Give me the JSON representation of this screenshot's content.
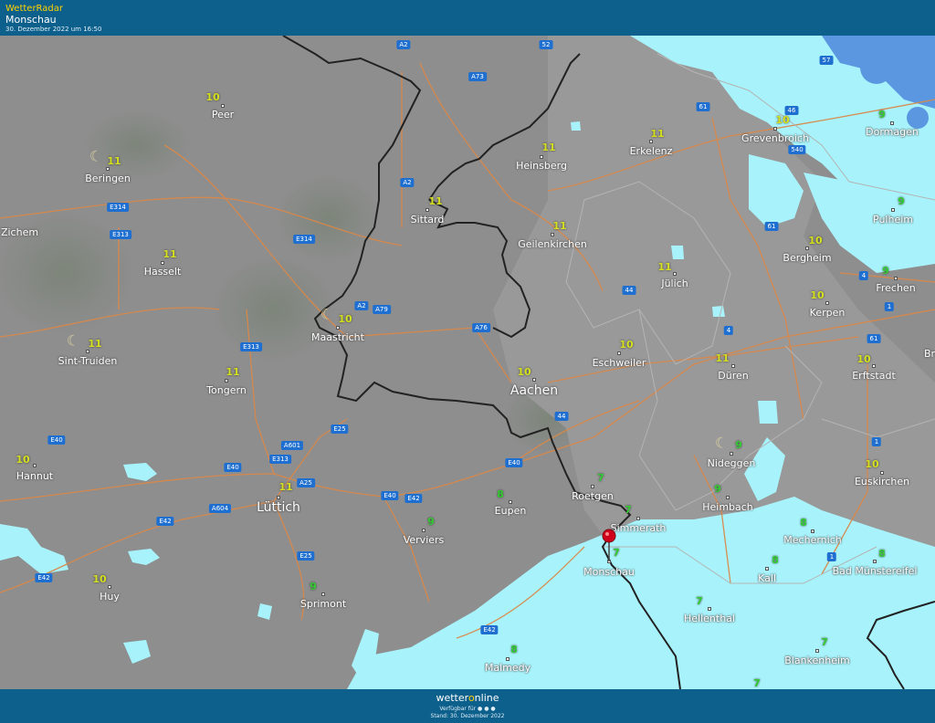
{
  "header": {
    "brand": "WetterRadar",
    "location": "Monschau",
    "timestamp": "30. Dezember 2022 um 16:50"
  },
  "footer": {
    "logo_a": "wetter",
    "logo_b": "o",
    "logo_c": "nline",
    "available": "Verfügbar für",
    "stand": "Stand: 30. Dezember 2022"
  },
  "colors": {
    "header_bg": "#0d5f8c",
    "brand": "#ffd200",
    "land": "#8f8f8f",
    "precip_light": "#a8f3fb",
    "temp_10_11": "#d4e020",
    "temp_7_9": "#33cc33",
    "road_label": "#1f6fd1",
    "marker": "#d0021b"
  },
  "cities": [
    {
      "name": "Peer",
      "temp": "10"
    },
    {
      "name": "Beringen",
      "temp": "11"
    },
    {
      "name": "Hasselt",
      "temp": "11"
    },
    {
      "name": "Sint-Truiden",
      "temp": "11"
    },
    {
      "name": "Tongern",
      "temp": "11"
    },
    {
      "name": "Hannut",
      "temp": "10"
    },
    {
      "name": "Huy",
      "temp": "10"
    },
    {
      "name": "Lüttich",
      "temp": "11"
    },
    {
      "name": "Sprimont",
      "temp": "9"
    },
    {
      "name": "Verviers",
      "temp": "9"
    },
    {
      "name": "Eupen",
      "temp": "8"
    },
    {
      "name": "Malmedy",
      "temp": "8"
    },
    {
      "name": "Maastricht",
      "temp": "10"
    },
    {
      "name": "Sittard",
      "temp": "11"
    },
    {
      "name": "Heinsberg",
      "temp": "11"
    },
    {
      "name": "Geilenkirchen",
      "temp": "11"
    },
    {
      "name": "Erkelenz",
      "temp": "11"
    },
    {
      "name": "Jülich",
      "temp": "11"
    },
    {
      "name": "Aachen",
      "temp": "10"
    },
    {
      "name": "Eschweiler",
      "temp": "10"
    },
    {
      "name": "Düren",
      "temp": "11"
    },
    {
      "name": "Roetgen",
      "temp": "7"
    },
    {
      "name": "Simmerath",
      "temp": "7"
    },
    {
      "name": "Monschau",
      "temp": "7"
    },
    {
      "name": "Nideggen",
      "temp": "9"
    },
    {
      "name": "Heimbach",
      "temp": "9"
    },
    {
      "name": "Hellenthal",
      "temp": "7"
    },
    {
      "name": "Kall",
      "temp": "8"
    },
    {
      "name": "Mechernich",
      "temp": "8"
    },
    {
      "name": "Blankenheim",
      "temp": "7"
    },
    {
      "name": "Bad Münstereifel",
      "temp": "8"
    },
    {
      "name": "Euskirchen",
      "temp": "10"
    },
    {
      "name": "Erftstadt",
      "temp": "10"
    },
    {
      "name": "Kerpen",
      "temp": "10"
    },
    {
      "name": "Frechen",
      "temp": "9"
    },
    {
      "name": "Bergheim",
      "temp": "10"
    },
    {
      "name": "Pulheim",
      "temp": "9"
    },
    {
      "name": "Dormagen",
      "temp": "9"
    },
    {
      "name": "Grevenbroich",
      "temp": "10"
    },
    {
      "name": "l-Zichem",
      "temp": ""
    },
    {
      "name": "Br",
      "temp": ""
    }
  ],
  "extra_temps": [
    "7"
  ],
  "roads": [
    "A2",
    "A73",
    "52",
    "57",
    "61",
    "46",
    "540",
    "A2",
    "E314",
    "E313",
    "E314",
    "61",
    "A2",
    "A79",
    "A76",
    "44",
    "4",
    "4",
    "1",
    "E313",
    "61",
    "44",
    "E25",
    "E40",
    "A601",
    "E313",
    "E40",
    "A25",
    "A604",
    "E42",
    "E40",
    "E42",
    "E40",
    "E25",
    "E42",
    "E42",
    "1",
    "1"
  ]
}
